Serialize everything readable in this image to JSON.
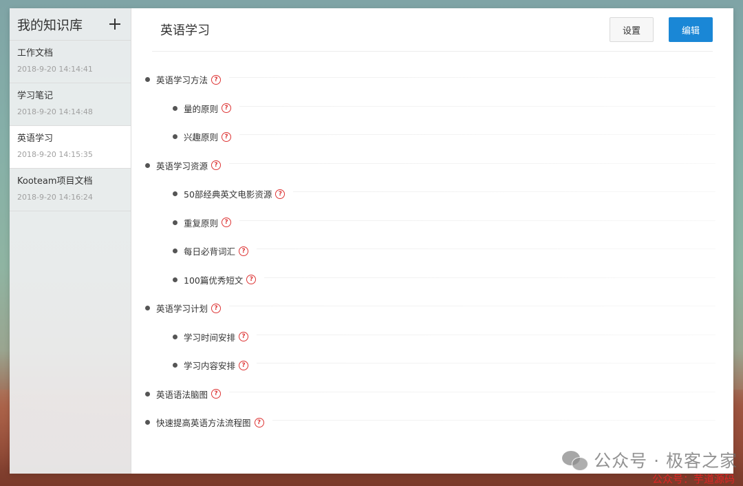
{
  "sidebar": {
    "title": "我的知识库",
    "add_icon": "plus-icon",
    "items": [
      {
        "name": "工作文档",
        "time": "2018-9-20 14:14:41",
        "active": false
      },
      {
        "name": "学习笔记",
        "time": "2018-9-20 14:14:48",
        "active": false
      },
      {
        "name": "英语学习",
        "time": "2018-9-20 14:15:35",
        "active": true
      },
      {
        "name": "Kooteam项目文档",
        "time": "2018-9-20 14:16:24",
        "active": false
      }
    ]
  },
  "main": {
    "title": "英语学习",
    "settings_label": "设置",
    "edit_label": "编辑",
    "tree": [
      {
        "label": "英语学习方法",
        "level": 1
      },
      {
        "label": "量的原则",
        "level": 2
      },
      {
        "label": "兴趣原则",
        "level": 2
      },
      {
        "label": "英语学习资源",
        "level": 1
      },
      {
        "label": "50部经典英文电影资源",
        "level": 2
      },
      {
        "label": "重复原则",
        "level": 2
      },
      {
        "label": "每日必背词汇",
        "level": 2
      },
      {
        "label": "100篇优秀短文",
        "level": 2
      },
      {
        "label": "英语学习计划",
        "level": 1
      },
      {
        "label": "学习时间安排",
        "level": 2
      },
      {
        "label": "学习内容安排",
        "level": 2
      },
      {
        "label": "英语语法脑图",
        "level": 1
      },
      {
        "label": "快速提高英语方法流程图",
        "level": 1
      }
    ],
    "help_glyph": "?"
  },
  "watermark": {
    "text": "公众号 · 极客之家",
    "icon": "wechat-icon",
    "subtext": "公众号：芋道源码"
  },
  "colors": {
    "accent": "#1a87d6",
    "help": "#d33333",
    "watermark_red": "#e02525"
  }
}
